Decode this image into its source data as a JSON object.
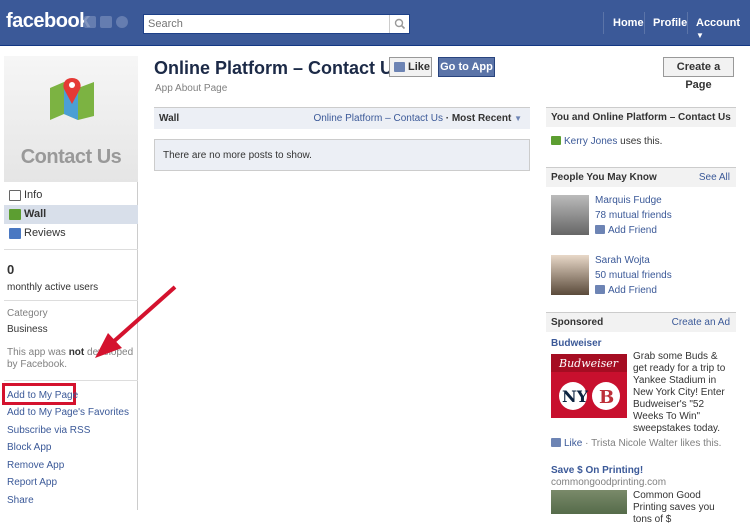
{
  "topbar": {
    "logo": "facebook",
    "search_placeholder": "Search",
    "nav": [
      "Home",
      "Profile",
      "Account"
    ]
  },
  "left": {
    "profile_title": "Contact Us",
    "nav": [
      "Info",
      "Wall",
      "Reviews"
    ],
    "users_count": "0",
    "users_label": "monthly active users",
    "category_label": "Category",
    "category_value": "Business",
    "dev_note_a": "This app was ",
    "dev_note_b": "not",
    "dev_note_c": " developed by Facebook.",
    "actions": [
      "Add to My Page",
      "Add to My Page's Favorites",
      "Subscribe via RSS",
      "Block App",
      "Remove App",
      "Report App",
      "Share"
    ]
  },
  "main": {
    "title": "Online Platform – Contact Us",
    "like_label": "Like",
    "go_label": "Go to App",
    "subtitle": "App About Page",
    "create_label": "Create a Page",
    "wall_label": "Wall",
    "wall_filter_link": "Online Platform – Contact Us",
    "wall_filter_sep": " · ",
    "wall_filter_sel": "Most Recent",
    "wall_empty": "There are no more posts to show."
  },
  "right": {
    "you_title": "You and Online Platform – Contact Us",
    "you_user": "Kerry Jones",
    "you_text": " uses this.",
    "pymk_title": "People You May Know",
    "see_all": "See All",
    "people": [
      {
        "name": "Marquis Fudge",
        "mutual": "78 mutual friends",
        "add": "Add Friend"
      },
      {
        "name": "Sarah Wojta",
        "mutual": "50 mutual friends",
        "add": "Add Friend"
      }
    ],
    "sponsored": "Sponsored",
    "create_ad": "Create an Ad",
    "ad1_title": "Budweiser",
    "ad1_text": "Grab some Buds & get ready for a trip to Yankee Stadium in New York City! Enter Budweiser's \"52 Weeks To Win\" sweepstakes today.",
    "ad1_like": "Like",
    "ad1_social": " · Trista Nicole Walter likes this.",
    "ad2_title": "Save $ On Printing!",
    "ad2_url": "commongoodprinting.com",
    "ad2_text": "Common Good Printing saves you tons of $"
  },
  "colors": {
    "brand": "#3b5998",
    "annotation": "#d4122e"
  }
}
